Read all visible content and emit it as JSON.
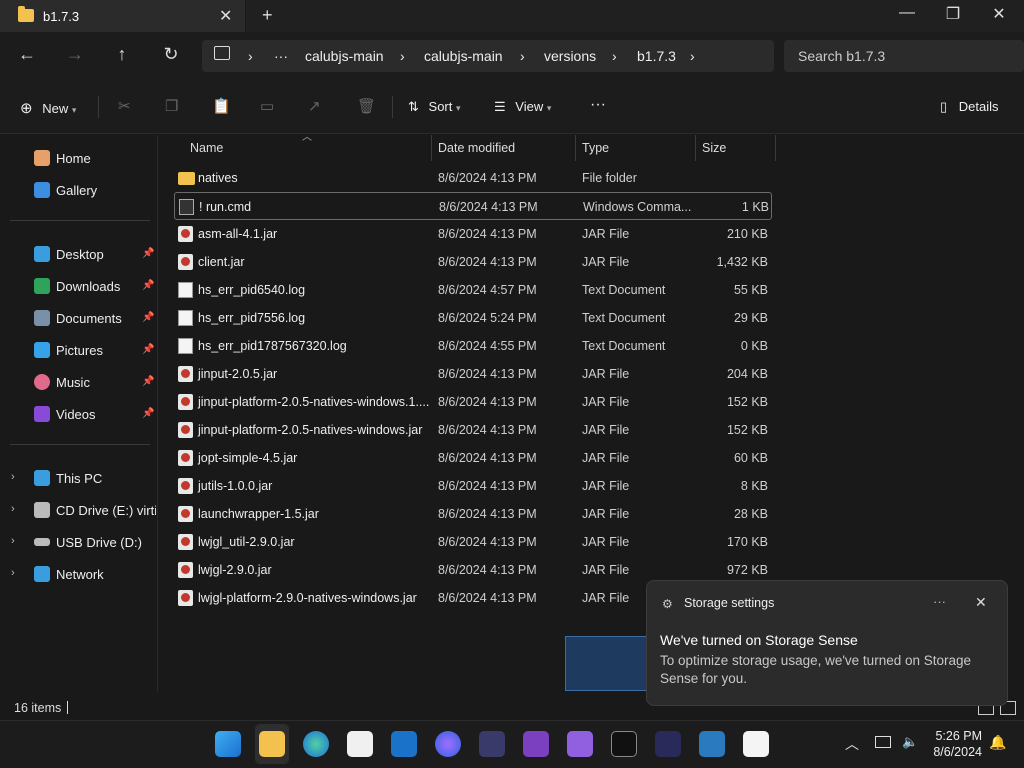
{
  "window": {
    "tab_title": "b1.7.3",
    "tab_close": "✕",
    "new_tab": "+",
    "minimize": "—",
    "maximize": "❐",
    "close": "✕"
  },
  "nav": {
    "back": "←",
    "forward": "→",
    "up": "↑",
    "refresh": "↻",
    "breadcrumb": [
      "calubjs-main",
      "calubjs-main",
      "versions",
      "b1.7.3"
    ],
    "overflow": "···",
    "search_placeholder": "Search b1.7.3"
  },
  "commands": {
    "new": "New",
    "sort": "Sort",
    "view": "View",
    "more": "···",
    "details": "Details"
  },
  "sidebar": {
    "items": [
      {
        "label": "Home",
        "icon": "home-icon"
      },
      {
        "label": "Gallery",
        "icon": "gallery-icon"
      },
      {
        "label": "Desktop",
        "icon": "desktop-icon",
        "pinned": true
      },
      {
        "label": "Downloads",
        "icon": "downloads-icon",
        "pinned": true
      },
      {
        "label": "Documents",
        "icon": "documents-icon",
        "pinned": true
      },
      {
        "label": "Pictures",
        "icon": "pictures-icon",
        "pinned": true
      },
      {
        "label": "Music",
        "icon": "music-icon",
        "pinned": true
      },
      {
        "label": "Videos",
        "icon": "videos-icon",
        "pinned": true
      },
      {
        "label": "This PC",
        "icon": "pc-icon"
      },
      {
        "label": "CD Drive (E:) virtio-",
        "icon": "cd-drive-icon"
      },
      {
        "label": "USB Drive (D:)",
        "icon": "usb-drive-icon"
      },
      {
        "label": "Network",
        "icon": "network-icon"
      }
    ]
  },
  "columns": {
    "name": "Name",
    "date": "Date modified",
    "type": "Type",
    "size": "Size"
  },
  "files": [
    {
      "name": "natives",
      "date": "8/6/2024 4:13 PM",
      "type": "File folder",
      "size": "",
      "icon": "folder"
    },
    {
      "name": "! run.cmd",
      "date": "8/6/2024 4:13 PM",
      "type": "Windows Comma...",
      "size": "1 KB",
      "icon": "cmd"
    },
    {
      "name": "asm-all-4.1.jar",
      "date": "8/6/2024 4:13 PM",
      "type": "JAR File",
      "size": "210 KB",
      "icon": "jar"
    },
    {
      "name": "client.jar",
      "date": "8/6/2024 4:13 PM",
      "type": "JAR File",
      "size": "1,432 KB",
      "icon": "jar"
    },
    {
      "name": "hs_err_pid6540.log",
      "date": "8/6/2024 4:57 PM",
      "type": "Text Document",
      "size": "55 KB",
      "icon": "text"
    },
    {
      "name": "hs_err_pid7556.log",
      "date": "8/6/2024 5:24 PM",
      "type": "Text Document",
      "size": "29 KB",
      "icon": "text"
    },
    {
      "name": "hs_err_pid1787567320.log",
      "date": "8/6/2024 4:55 PM",
      "type": "Text Document",
      "size": "0 KB",
      "icon": "text"
    },
    {
      "name": "jinput-2.0.5.jar",
      "date": "8/6/2024 4:13 PM",
      "type": "JAR File",
      "size": "204 KB",
      "icon": "jar"
    },
    {
      "name": "jinput-platform-2.0.5-natives-windows.1....",
      "date": "8/6/2024 4:13 PM",
      "type": "JAR File",
      "size": "152 KB",
      "icon": "jar"
    },
    {
      "name": "jinput-platform-2.0.5-natives-windows.jar",
      "date": "8/6/2024 4:13 PM",
      "type": "JAR File",
      "size": "152 KB",
      "icon": "jar"
    },
    {
      "name": "jopt-simple-4.5.jar",
      "date": "8/6/2024 4:13 PM",
      "type": "JAR File",
      "size": "60 KB",
      "icon": "jar"
    },
    {
      "name": "jutils-1.0.0.jar",
      "date": "8/6/2024 4:13 PM",
      "type": "JAR File",
      "size": "8 KB",
      "icon": "jar"
    },
    {
      "name": "launchwrapper-1.5.jar",
      "date": "8/6/2024 4:13 PM",
      "type": "JAR File",
      "size": "28 KB",
      "icon": "jar"
    },
    {
      "name": "lwjgl_util-2.9.0.jar",
      "date": "8/6/2024 4:13 PM",
      "type": "JAR File",
      "size": "170 KB",
      "icon": "jar"
    },
    {
      "name": "lwjgl-2.9.0.jar",
      "date": "8/6/2024 4:13 PM",
      "type": "JAR File",
      "size": "972 KB",
      "icon": "jar"
    },
    {
      "name": "lwjgl-platform-2.9.0-natives-windows.jar",
      "date": "8/6/2024 4:13 PM",
      "type": "JAR File",
      "size": "",
      "icon": "jar"
    }
  ],
  "status": {
    "count": "16 items"
  },
  "toast": {
    "app": "Storage settings",
    "more": "···",
    "close": "✕",
    "title": "We've turned on Storage Sense",
    "body": "To optimize storage usage, we've turned on Storage Sense for you."
  },
  "clock": {
    "time": "5:26 PM",
    "date": "8/6/2024"
  },
  "tray": {
    "chevron": "︿"
  }
}
